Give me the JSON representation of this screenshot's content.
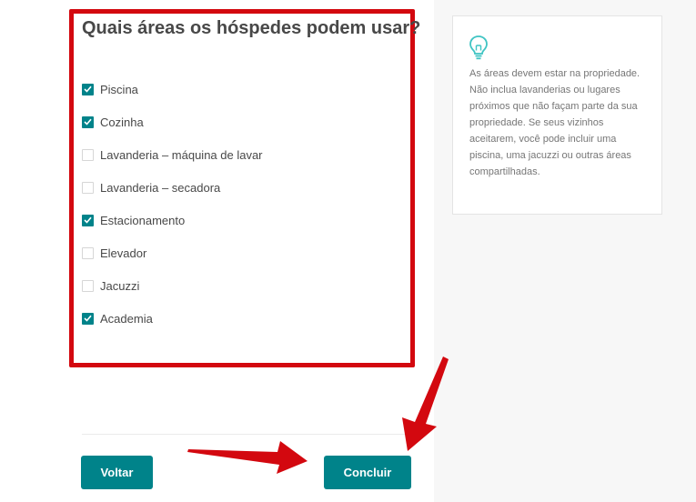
{
  "heading": "Quais áreas os hóspedes podem usar?",
  "amenities": [
    {
      "label": "Piscina",
      "checked": true
    },
    {
      "label": "Cozinha",
      "checked": true
    },
    {
      "label": "Lavanderia – máquina de lavar",
      "checked": false
    },
    {
      "label": "Lavanderia – secadora",
      "checked": false
    },
    {
      "label": "Estacionamento",
      "checked": true
    },
    {
      "label": "Elevador",
      "checked": false
    },
    {
      "label": "Jacuzzi",
      "checked": false
    },
    {
      "label": "Academia",
      "checked": true
    }
  ],
  "tip": {
    "icon": "lightbulb-icon",
    "text": "As áreas devem estar na propriedade. Não inclua lavanderias ou lugares próximos que não façam parte da sua propriedade. Se seus vizinhos aceitarem, você pode incluir uma piscina, uma jacuzzi ou outras áreas compartilhadas."
  },
  "buttons": {
    "back_label": "Voltar",
    "done_label": "Concluir"
  },
  "colors": {
    "accent": "#00838a",
    "highlight": "#d3080f",
    "tip_icon": "#3fc4c3"
  }
}
